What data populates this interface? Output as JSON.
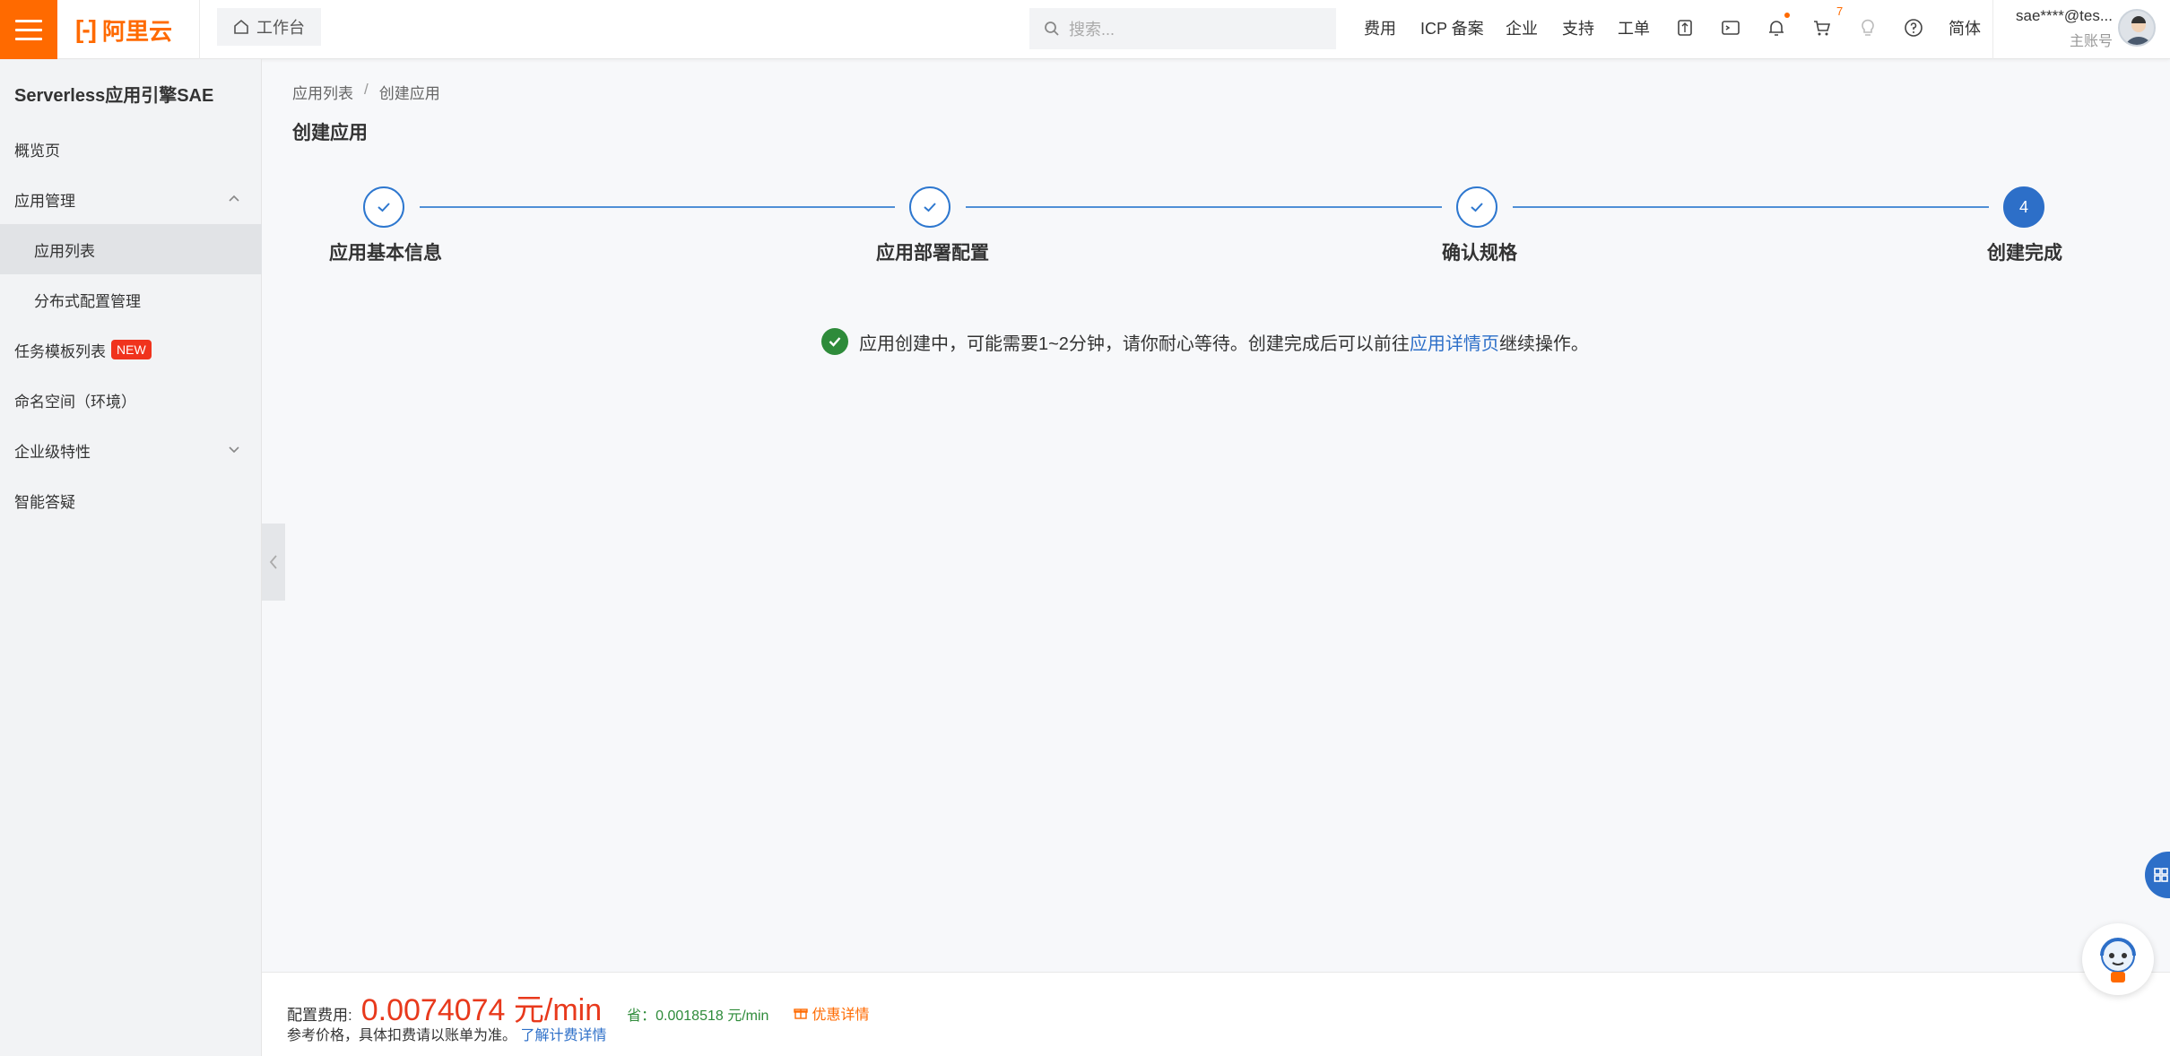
{
  "topbar": {
    "logo_text": "阿里云",
    "workbench_label": "工作台",
    "search_placeholder": "搜索...",
    "links": [
      "费用",
      "ICP 备案",
      "企业",
      "支持",
      "工单"
    ],
    "cart_count": "7",
    "language": "简体",
    "account_email": "sae****@tes...",
    "account_role": "主账号"
  },
  "sidebar": {
    "title": "Serverless应用引擎SAE",
    "items": [
      {
        "label": "概览页"
      },
      {
        "label": "应用管理"
      },
      {
        "label": "应用列表"
      },
      {
        "label": "分布式配置管理"
      },
      {
        "label": "任务模板列表",
        "badge": "NEW"
      },
      {
        "label": "命名空间（环境）"
      },
      {
        "label": "企业级特性"
      },
      {
        "label": "智能答疑"
      }
    ]
  },
  "breadcrumb": {
    "items": [
      "应用列表",
      "创建应用"
    ],
    "separator": "/"
  },
  "page_title": "创建应用",
  "steps": [
    {
      "label": "应用基本信息",
      "status": "done"
    },
    {
      "label": "应用部署配置",
      "status": "done"
    },
    {
      "label": "确认规格",
      "status": "done"
    },
    {
      "label": "创建完成",
      "status": "current",
      "number": "4"
    }
  ],
  "message": {
    "text": "应用创建中，可能需要1~2分钟，请你耐心等待。创建完成后可以前往",
    "link": "应用详情页",
    "suffix": "继续操作。"
  },
  "footer": {
    "fee_label": "配置费用:",
    "fee_price": "0.0074074 元/min",
    "save_text": "省：0.0018518 元/min",
    "deal_text": "优惠详情",
    "note_text": "参考价格，具体扣费请以账单为准。",
    "note_link": "了解计费详情"
  },
  "colors": {
    "brand": "#ff6a00",
    "primary": "#2d6fc8",
    "success": "#2e8b3a",
    "price": "#e8391c"
  }
}
